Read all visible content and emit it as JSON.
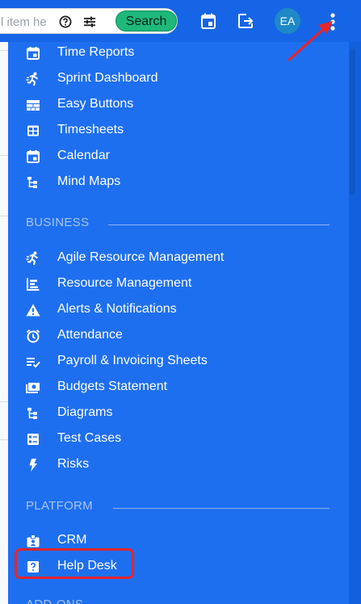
{
  "header": {
    "search_placeholder": "l item he",
    "search_button": "Search",
    "avatar_initials": "EA",
    "icons": [
      "help-icon",
      "tune-icon",
      "calendar-icon",
      "exit-icon",
      "more-vertical-icon"
    ]
  },
  "menu": {
    "top_items": [
      {
        "label": "Time Reports",
        "icon": "calendar-icon"
      },
      {
        "label": "Sprint Dashboard",
        "icon": "run-icon"
      },
      {
        "label": "Easy Buttons",
        "icon": "grid-buttons-icon"
      },
      {
        "label": "Timesheets",
        "icon": "table-icon"
      },
      {
        "label": "Calendar",
        "icon": "calendar-icon"
      },
      {
        "label": "Mind Maps",
        "icon": "tree-icon"
      }
    ],
    "business": {
      "title": "BUSINESS",
      "items": [
        {
          "label": "Agile Resource Management",
          "icon": "run-icon"
        },
        {
          "label": "Resource Management",
          "icon": "chart-icon"
        },
        {
          "label": "Alerts & Notifications",
          "icon": "warning-icon"
        },
        {
          "label": "Attendance",
          "icon": "alarm-icon"
        },
        {
          "label": "Payroll & Invoicing Sheets",
          "icon": "list-check-icon"
        },
        {
          "label": "Budgets Statement",
          "icon": "money-icon"
        },
        {
          "label": "Diagrams",
          "icon": "tree-icon"
        },
        {
          "label": "Test Cases",
          "icon": "checklist-icon"
        },
        {
          "label": "Risks",
          "icon": "bolt-icon"
        }
      ]
    },
    "platform": {
      "title": "PLATFORM",
      "items": [
        {
          "label": "CRM",
          "icon": "badge-icon"
        },
        {
          "label": "Help Desk",
          "icon": "help-box-icon"
        }
      ]
    },
    "next_section_partial": "ADD-ONS"
  },
  "colors": {
    "header_bg": "#1565e6",
    "menu_bg": "#1e6ff0",
    "search_button_bg": "#1db97a",
    "highlight_border": "#e8242b",
    "annotation_arrow": "#e8242b"
  }
}
